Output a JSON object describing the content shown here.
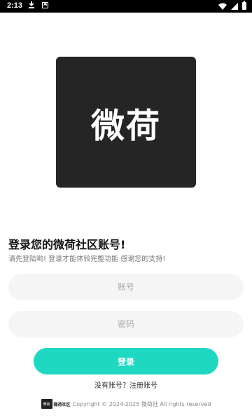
{
  "status_bar": {
    "time": "2:13",
    "icons": [
      "download-icon",
      "image-icon",
      "wifi-icon",
      "signal-icon",
      "battery-icon"
    ]
  },
  "logo": {
    "text": "微荷"
  },
  "header": {
    "title": "登录您的微荷社区账号!",
    "subtitle": "请先登陆哟! 登录才能体验完整功能 感谢您的支持!"
  },
  "form": {
    "account_placeholder": "账号",
    "password_placeholder": "密码",
    "login_label": "登录",
    "register_text": "没有账号？注册账号"
  },
  "footer": {
    "logo_badge": "微荷",
    "logo_text": "微荷社区",
    "copyright": "Copyright © 2024-2025 微荷社 All rights reserved"
  },
  "colors": {
    "accent": "#1ed8c2",
    "logo_bg": "#252525",
    "field_bg": "#f5f5f5"
  }
}
